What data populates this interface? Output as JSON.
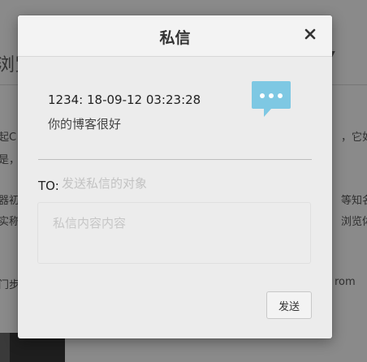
{
  "background": {
    "title_fragment": "浏览",
    "caret": "▼",
    "text_fragments": [
      "起C",
      "，它如",
      "是，",
      "器初",
      "等知名",
      "实称",
      "浏览体",
      "门步",
      "rom"
    ]
  },
  "dialog": {
    "title": "私信",
    "close_glyph": "×",
    "message": {
      "meta": "1234: 18-09-12 03:23:28",
      "body": "你的博客很好"
    },
    "to_label": "TO:",
    "to_placeholder": "发送私信的对象",
    "content_placeholder": "私信内容内容",
    "send_label": "发送",
    "icon": "chat-bubble-icon",
    "icon_color": "#7ec8e3"
  }
}
